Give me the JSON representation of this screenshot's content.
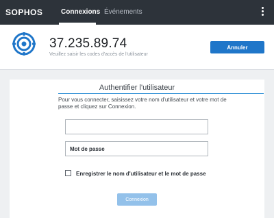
{
  "app": {
    "brand": "SOPHOS"
  },
  "nav": {
    "tabs": [
      {
        "label": "Connexions",
        "active": true
      },
      {
        "label": "Événements",
        "active": false
      }
    ]
  },
  "header": {
    "ip": "37.235.89.74",
    "subtext": "Veuillez saisir les codes d'accès de l'utilisateur",
    "cancel_label": "Annuler"
  },
  "auth": {
    "title": "Authentifier l'utilisateur",
    "instructions": "Pour vous connecter, saisissez votre nom d'utilisateur et votre mot de passe et cliquez sur Connexion.",
    "username": {
      "value": "",
      "placeholder": ""
    },
    "password": {
      "value": "",
      "placeholder": "Mot de passe"
    },
    "remember": {
      "label": "Enregistrer le nom d'utilisateur et le mot de passe",
      "checked": false
    },
    "connect_label": "Connexion"
  },
  "colors": {
    "topbar": "#2d333a",
    "accent": "#1f76c9",
    "connect_disabled": "#93c1ea",
    "divider": "#2d8fd5"
  },
  "icons": {
    "host": "target-host-icon",
    "menu": "kebab-menu-icon"
  }
}
